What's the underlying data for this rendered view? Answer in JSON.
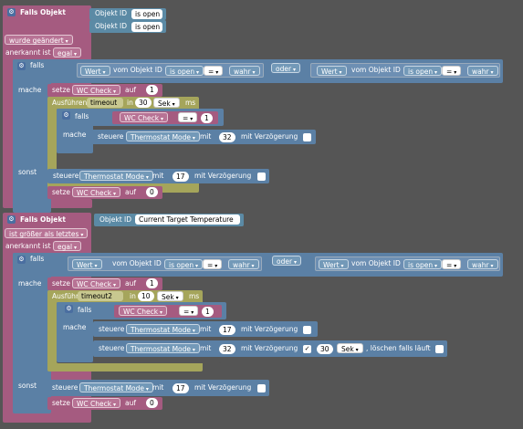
{
  "colors": {
    "trigger": "#a55b80",
    "logic": "#5b80a5",
    "timeout": "#a5a55b",
    "background": "#555555"
  },
  "trigger1": {
    "title": "Falls Objekt",
    "oid_label": "Objekt ID",
    "oid1": "is open",
    "oid2": "is open",
    "event": "wurde geändert",
    "ack_label": "anerkannt ist",
    "ack": "egal"
  },
  "if1": {
    "falls": "falls",
    "mache": "mache",
    "sonst": "sonst",
    "cond_a": {
      "value": "Wert",
      "of": "vom Objekt ID",
      "oid": "is open",
      "op": "=",
      "cmp": "wahr"
    },
    "oder": "oder",
    "cond_b": {
      "value": "Wert",
      "of": "vom Objekt ID",
      "oid": "is open",
      "op": "=",
      "cmp": "wahr"
    },
    "set1": {
      "setze": "setze",
      "var": "WC Check",
      "auf": "auf",
      "val": "1"
    },
    "timeout": {
      "label": "Ausführen",
      "name": "timeout",
      "in": "in",
      "val": "30",
      "unit": "Sek",
      "ms": "ms"
    },
    "inner_if": {
      "falls": "falls",
      "mache": "mache",
      "var": "WC Check",
      "op": "=",
      "val": "1"
    },
    "control1": {
      "steuere": "steuere",
      "target": "Thermostat Mode",
      "mit": "mit",
      "val": "32",
      "delay": "mit Verzögerung"
    },
    "sonst_control": {
      "steuere": "steuere",
      "target": "Thermostat Mode",
      "mit": "mit",
      "val": "17",
      "delay": "mit Verzögerung"
    },
    "sonst_set": {
      "setze": "setze",
      "var": "WC Check",
      "auf": "auf",
      "val": "0"
    }
  },
  "trigger2": {
    "title": "Falls Objekt",
    "oid_label": "Objekt ID",
    "oid": "Current Target Temperature",
    "event": "ist größer als letztes",
    "ack_label": "anerkannt ist",
    "ack": "egal"
  },
  "if2": {
    "falls": "falls",
    "mache": "mache",
    "sonst": "sonst",
    "cond_a": {
      "value": "Wert",
      "of": "vom Objekt ID",
      "oid": "is open",
      "op": "=",
      "cmp": "wahr"
    },
    "oder": "oder",
    "cond_b": {
      "value": "Wert",
      "of": "vom Objekt ID",
      "oid": "is open",
      "op": "=",
      "cmp": "wahr"
    },
    "set1": {
      "setze": "setze",
      "var": "WC Check",
      "auf": "auf",
      "val": "1"
    },
    "timeout": {
      "label": "Ausführen",
      "name": "timeout2",
      "in": "in",
      "val": "10",
      "unit": "Sek",
      "ms": "ms"
    },
    "inner_if": {
      "falls": "falls",
      "mache": "mache",
      "var": "WC Check",
      "op": "=",
      "val": "1"
    },
    "control1": {
      "steuere": "steuere",
      "target": "Thermostat Mode",
      "mit": "mit",
      "val": "17",
      "delay": "mit Verzögerung"
    },
    "control2": {
      "steuere": "steuere",
      "target": "Thermostat Mode",
      "mit": "mit",
      "val": "32",
      "delay": "mit Verzögerung",
      "delay_val": "30",
      "delay_unit": "Sek",
      "clear": ", löschen falls läuft"
    },
    "sonst_control": {
      "steuere": "steuere",
      "target": "Thermostat Mode",
      "mit": "mit",
      "val": "17",
      "delay": "mit Verzögerung"
    },
    "sonst_set": {
      "setze": "setze",
      "var": "WC Check",
      "auf": "auf",
      "val": "0"
    }
  }
}
